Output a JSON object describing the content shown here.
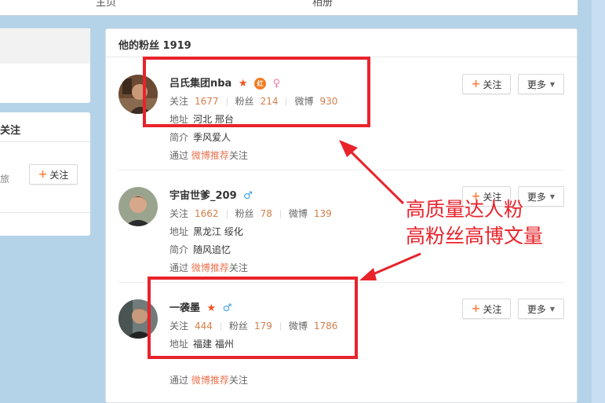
{
  "top_tabs": [
    {
      "label": "主页"
    },
    {
      "label": "相册"
    }
  ],
  "left_panel": {
    "card2_title": "关注",
    "card2_snippet": "旅",
    "follow_label": "关注"
  },
  "fans": {
    "header": "他的粉丝 1919",
    "labels": {
      "follow_stat": "关注",
      "fans_stat": "粉丝",
      "weibo_stat": "微博",
      "address": "地址",
      "intro": "简介",
      "via": "通过",
      "via_link": "微博推荐",
      "via_suffix": "关注",
      "follow_button": "关注",
      "more_button": "更多"
    },
    "items": [
      {
        "name": "吕氏集团nba",
        "gender": "female",
        "following": "1677",
        "followers": "214",
        "weibo": "930",
        "address": "河北 邢台",
        "intro": "季风爱人",
        "badge_hong": "红"
      },
      {
        "name": "宇宙世爹_209",
        "gender": "male",
        "following": "1662",
        "followers": "78",
        "weibo": "139",
        "address": "黑龙江 绥化",
        "intro": "随风追忆"
      },
      {
        "name": "一袭墨",
        "gender": "male",
        "following": "444",
        "followers": "179",
        "weibo": "1786",
        "address": "福建 福州",
        "intro": ""
      }
    ]
  },
  "annotation": {
    "line1": "高质量达人粉",
    "line2": "高粉丝高博文量",
    "color": "#e8232b"
  },
  "colors": {
    "link": "#eb7350",
    "number": "#d57e4a",
    "plus": "#ff8140",
    "star": "#f0521f",
    "male": "#3c9ee8",
    "female": "#f27ba5"
  },
  "icons": [
    "star-icon",
    "hong-badge-icon",
    "female-icon",
    "male-icon",
    "plus-icon",
    "caret-down-icon"
  ]
}
